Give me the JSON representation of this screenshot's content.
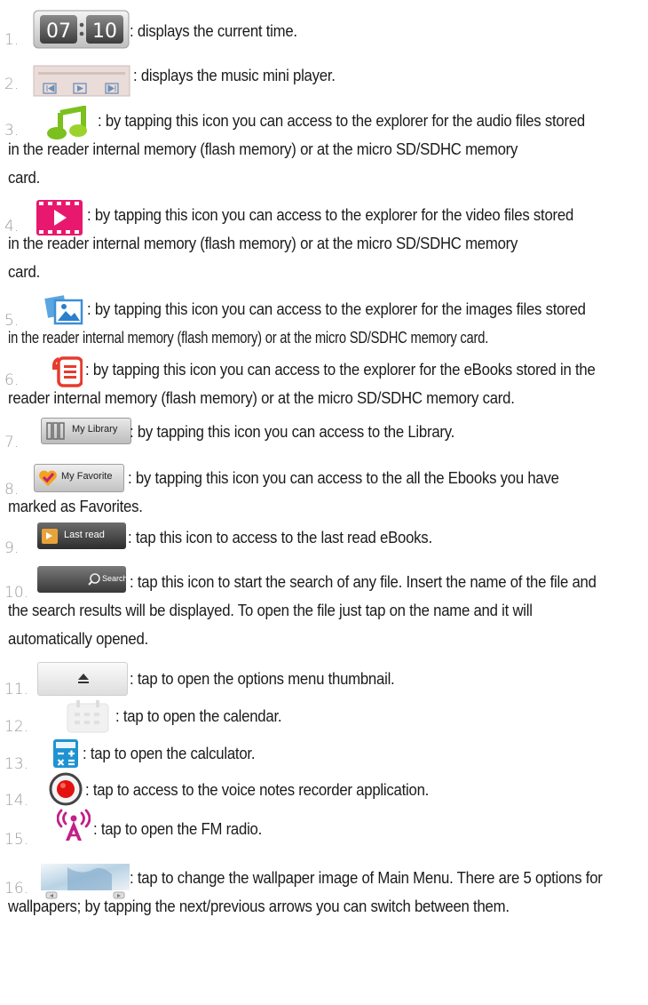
{
  "items": [
    {
      "n": "1.",
      "lines": [
        ": displays the current time."
      ],
      "icon": "clock-icon",
      "time_h": "07",
      "time_m": "10"
    },
    {
      "n": "2.",
      "lines": [
        ": displays   the music mini player."
      ],
      "icon": "music-mini-player-icon"
    },
    {
      "n": "3.",
      "lines": [
        ": by tapping this icon you can access to the explorer for the audio files stored",
        "in the reader internal memory (flash memory) or at the micro SD/SDHC memory",
        "card."
      ],
      "icon": "music-note-icon"
    },
    {
      "n": "4.",
      "lines": [
        ": by tapping this icon you can access to the explorer  for the video files stored",
        "in the reader internal memory (flash memory) or at the micro SD/SDHC memory",
        "card."
      ],
      "icon": "video-icon"
    },
    {
      "n": "5.",
      "lines": [
        ": by tapping this icon you can access to the explorer  for the images files stored",
        "in the reader internal memory (flash memory) or at the micro SD/SDHC memory card."
      ],
      "icon": "images-icon"
    },
    {
      "n": "6.",
      "lines": [
        ": by tapping this icon you can access to the explorer for the eBooks stored in the",
        "reader internal memory (flash memory) or at the micro SD/SDHC memory card."
      ],
      "icon": "ebooks-icon"
    },
    {
      "n": "7.",
      "lines": [
        ": by tapping this icon you can access to the Library."
      ],
      "icon": "my-library-icon",
      "label": "My Library"
    },
    {
      "n": "8.",
      "lines": [
        ": by tapping this icon you can access to the all the Ebooks you have",
        "marked as Favorites."
      ],
      "icon": "my-favorite-icon",
      "label": "My Favorite"
    },
    {
      "n": "9.",
      "lines": [
        ": tap this icon to access to the last read eBooks."
      ],
      "icon": "last-read-icon",
      "label": "Last read"
    },
    {
      "n": "10.",
      "lines": [
        ": tap this icon to start the search of any file. Insert the name of the file and",
        "the search results will be displayed. To open the file just tap on the name and it will",
        "automatically opened."
      ],
      "icon": "search-icon",
      "label": "Search"
    },
    {
      "n": "11.",
      "lines": [
        ": tap to open the options menu thumbnail."
      ],
      "icon": "options-menu-icon"
    },
    {
      "n": "12.",
      "lines": [
        ": tap to open the calendar."
      ],
      "icon": "calendar-icon"
    },
    {
      "n": "13.",
      "lines": [
        ": tap to open the calculator."
      ],
      "icon": "calculator-icon"
    },
    {
      "n": "14.",
      "lines": [
        ": tap to access to the voice notes recorder application."
      ],
      "icon": "voice-recorder-icon"
    },
    {
      "n": "15.",
      "lines": [
        ": tap to open the FM radio."
      ],
      "icon": "fm-radio-icon"
    },
    {
      "n": "16.",
      "lines": [
        ": tap to change the wallpaper image of Main Menu. There are 5 options for",
        "wallpapers; by tapping the next/previous arrows you can switch between them."
      ],
      "icon": "wallpaper-icon"
    }
  ]
}
